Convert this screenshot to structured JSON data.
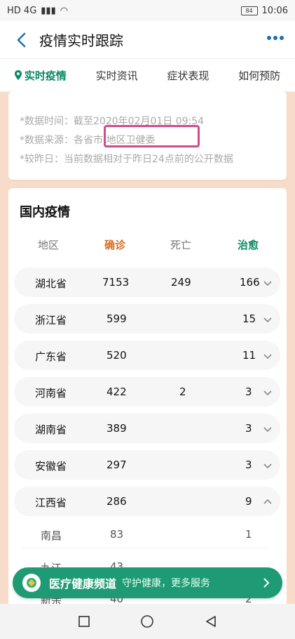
{
  "status": {
    "left_text": "HD 4G",
    "time": "10:06",
    "battery": "84"
  },
  "header": {
    "title": "疫情实时跟踪"
  },
  "tabs": [
    {
      "label": "实时疫情",
      "active": true
    },
    {
      "label": "实时资讯"
    },
    {
      "label": "症状表现"
    },
    {
      "label": "如何预防"
    }
  ],
  "info": {
    "time_line": "*数据时间：截至2020年02月01日 09:54",
    "source_line": "*数据来源：各省市 地区卫健委",
    "compare_line": "*较昨日：当前数据相对于昨日24点前的公开数据"
  },
  "domestic": {
    "title": "国内疫情",
    "headers": {
      "region": "地区",
      "confirmed": "确诊",
      "deaths": "死亡",
      "cured": "治愈"
    },
    "rows": [
      {
        "region": "湖北省",
        "confirmed": "7153",
        "deaths": "249",
        "cured": "166",
        "expanded": false
      },
      {
        "region": "浙江省",
        "confirmed": "599",
        "deaths": "",
        "cured": "15",
        "expanded": false
      },
      {
        "region": "广东省",
        "confirmed": "520",
        "deaths": "",
        "cured": "11",
        "expanded": false
      },
      {
        "region": "河南省",
        "confirmed": "422",
        "deaths": "2",
        "cured": "3",
        "expanded": false
      },
      {
        "region": "湖南省",
        "confirmed": "389",
        "deaths": "",
        "cured": "3",
        "expanded": false
      },
      {
        "region": "安徽省",
        "confirmed": "297",
        "deaths": "",
        "cured": "3",
        "expanded": false
      },
      {
        "region": "江西省",
        "confirmed": "286",
        "deaths": "",
        "cured": "9",
        "expanded": true
      }
    ],
    "subrows": [
      {
        "region": "南昌",
        "confirmed": "83",
        "deaths": "",
        "cured": "1"
      },
      {
        "region": "九江",
        "confirmed": "43",
        "deaths": "",
        "cured": ""
      },
      {
        "region": "新余",
        "confirmed": "40",
        "deaths": "",
        "cured": "2"
      }
    ]
  },
  "banner": {
    "title": "医疗健康频道",
    "subtitle": "守护健康，更多服务"
  },
  "colors": {
    "accent": "#0a8a63",
    "confirmed": "#d86b20",
    "banner": "#1e9b74"
  }
}
